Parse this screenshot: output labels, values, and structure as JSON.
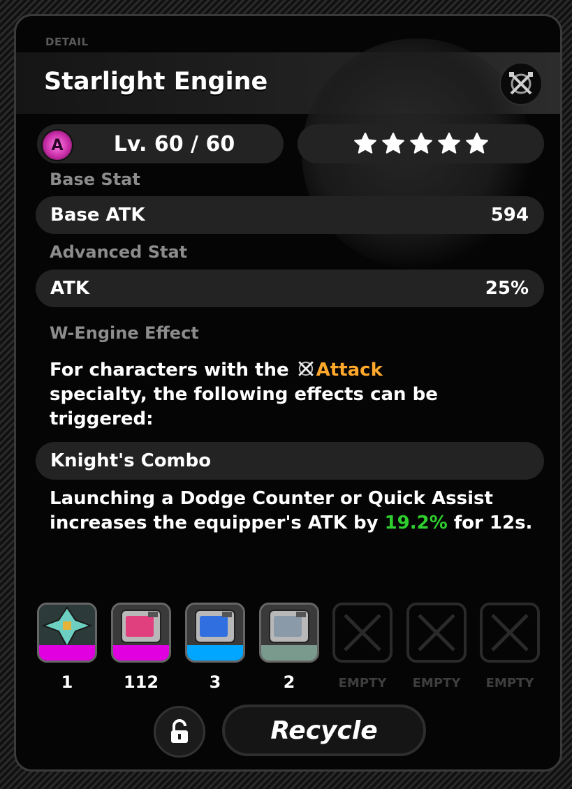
{
  "header": {
    "section_label": "DETAIL",
    "title": "Starlight Engine",
    "specialty_icon": "attack-specialty-icon"
  },
  "level": {
    "rank": "A",
    "text": "Lv. 60 / 60",
    "rank_color": "#d63bb4"
  },
  "stars": {
    "count": 5,
    "max": 5
  },
  "base_stat": {
    "label": "Base Stat",
    "name": "Base ATK",
    "value": "594"
  },
  "advanced_stat": {
    "label": "Advanced Stat",
    "name": "ATK",
    "value": "25%"
  },
  "effect": {
    "label": "W-Engine Effect",
    "intro_before": "For characters with the ",
    "specialty": "Attack",
    "intro_after": "specialty, the following effects can be triggered:",
    "skill_name": "Knight's Combo",
    "desc_before": "Launching a Dodge Counter or Quick Assist increases the equipper's ATK by ",
    "desc_value": "19.2%",
    "desc_after": " for 12s.",
    "accent_color": "#ffa82b",
    "value_color": "#2ecf2e"
  },
  "materials": [
    {
      "icon": "cross-material-icon",
      "count": "1",
      "strip_color": "#e000e0"
    },
    {
      "icon": "pink-crate-icon",
      "count": "112",
      "strip_color": "#e000e0"
    },
    {
      "icon": "blue-crate-icon",
      "count": "3",
      "strip_color": "#00a6ff"
    },
    {
      "icon": "gray-crate-icon",
      "count": "2",
      "strip_color": "#7a9a8e"
    },
    {
      "icon": "empty-slot-icon",
      "count": "EMPTY"
    },
    {
      "icon": "empty-slot-icon",
      "count": "EMPTY"
    },
    {
      "icon": "empty-slot-icon",
      "count": "EMPTY"
    }
  ],
  "actions": {
    "lock_icon": "unlock-icon",
    "recycle_label": "Recycle"
  }
}
